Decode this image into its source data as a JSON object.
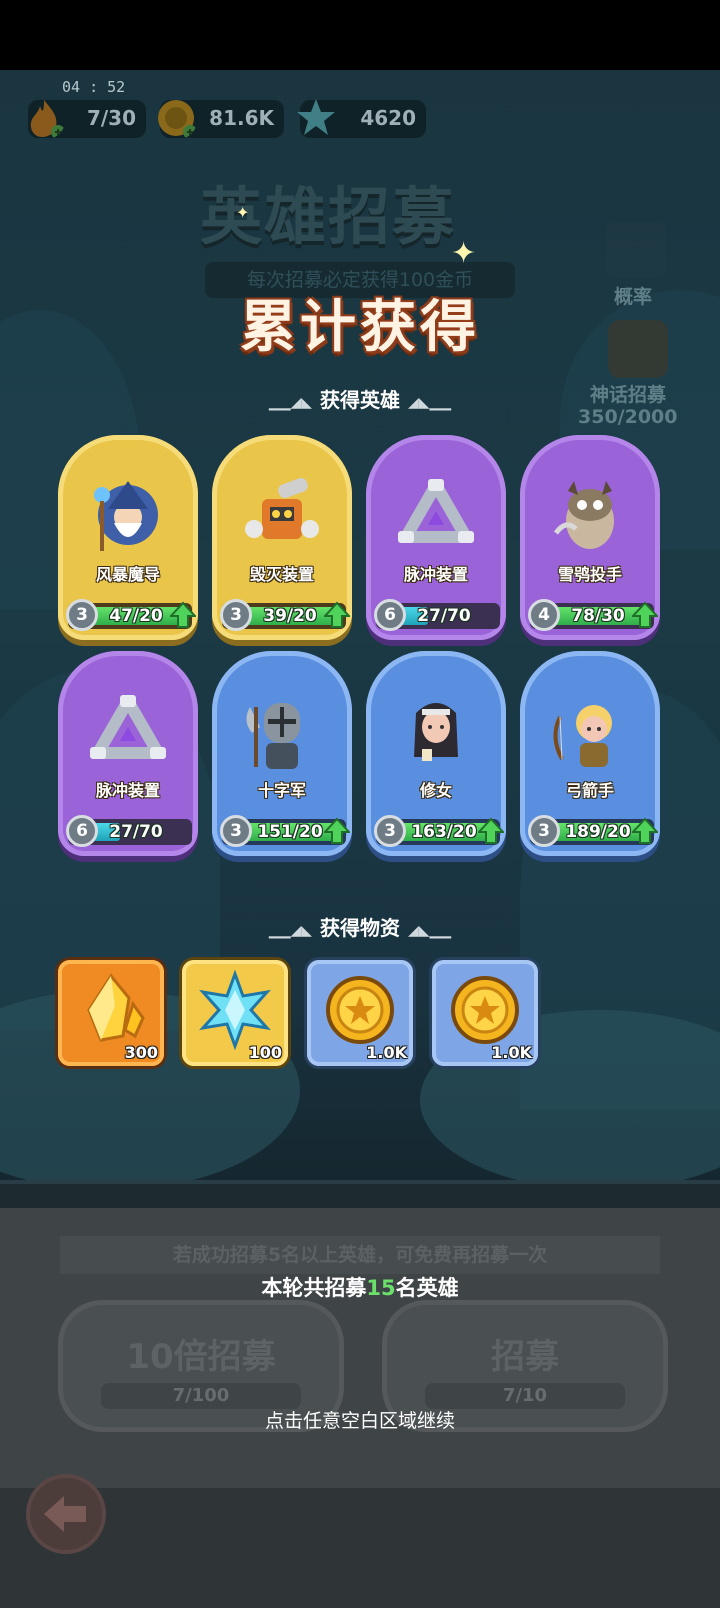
{
  "status": {
    "time": "04 : 52"
  },
  "resources": [
    {
      "name": "stamina",
      "icon": "fire-icon",
      "value": "7/30"
    },
    {
      "name": "gold",
      "icon": "coin-icon",
      "value": "81.6K"
    },
    {
      "name": "crystal",
      "icon": "snowflake-icon",
      "value": "4620"
    }
  ],
  "background": {
    "title": "英雄招募",
    "subtitle": "每次招募必定获得100金币",
    "rate_label": "概率",
    "mythic_label": "神话招募",
    "mythic_progress": "350/2000"
  },
  "popup": {
    "title": "累计获得",
    "heroes_section": "获得英雄",
    "items_section": "获得物资"
  },
  "heroes": [
    {
      "name": "风暴魔导",
      "rarity": "gold",
      "level": "3",
      "count": "47/20",
      "progress": 1.0,
      "upgradable": true
    },
    {
      "name": "毁灭装置",
      "rarity": "gold",
      "level": "3",
      "count": "39/20",
      "progress": 1.0,
      "upgradable": true
    },
    {
      "name": "脉冲装置",
      "rarity": "purple",
      "level": "6",
      "count": "27/70",
      "progress": 0.39,
      "upgradable": false
    },
    {
      "name": "雪鸮投手",
      "rarity": "purple",
      "level": "4",
      "count": "78/30",
      "progress": 1.0,
      "upgradable": true
    },
    {
      "name": "脉冲装置",
      "rarity": "purple",
      "level": "6",
      "count": "27/70",
      "progress": 0.39,
      "upgradable": false
    },
    {
      "name": "十字军",
      "rarity": "blue",
      "level": "3",
      "count": "151/20",
      "progress": 1.0,
      "upgradable": true
    },
    {
      "name": "修女",
      "rarity": "blue",
      "level": "3",
      "count": "163/20",
      "progress": 1.0,
      "upgradable": true
    },
    {
      "name": "弓箭手",
      "rarity": "blue",
      "level": "3",
      "count": "189/20",
      "progress": 1.0,
      "upgradable": true
    }
  ],
  "items": [
    {
      "icon": "gold-crystal-icon",
      "frame": "orange",
      "qty": "300"
    },
    {
      "icon": "ice-crystal-icon",
      "frame": "yellow",
      "qty": "100"
    },
    {
      "icon": "gold-coin-icon",
      "frame": "blue",
      "qty": "1.0K"
    },
    {
      "icon": "gold-coin-icon",
      "frame": "blue",
      "qty": "1.0K"
    }
  ],
  "footer": {
    "hint": "若成功招募5名以上英雄，可免费再招募一次",
    "round_prefix": "本轮共招募",
    "round_count": "15",
    "round_suffix": "名英雄",
    "ten_label": "10倍招募",
    "ten_keys": "7/100",
    "single_label": "招募",
    "single_keys": "7/10",
    "continue": "点击任意空白区域继续"
  },
  "colors": {
    "gold_frame": "#e9c54a",
    "purple_frame": "#9a63d8",
    "blue_frame": "#5a8fe0",
    "progress_green": "#3fc456",
    "highlight_green": "#6be06b"
  }
}
